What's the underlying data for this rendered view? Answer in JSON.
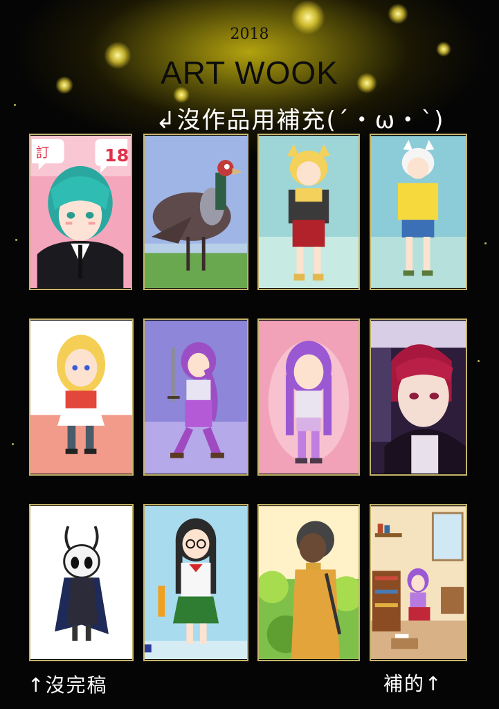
{
  "header": {
    "year": "2018",
    "title": "ART WOOK"
  },
  "notes": {
    "top": "↲沒作品用補充(´・ω・`)",
    "bottom_left": "↑沒完稿",
    "bottom_right": "補的↑"
  },
  "panels": {
    "p1_sign_left": "訂",
    "p1_sign_right": "18"
  },
  "colors": {
    "glow": "#b3a20f",
    "frame": "#c6b46a",
    "note_text": "#ffffff"
  }
}
